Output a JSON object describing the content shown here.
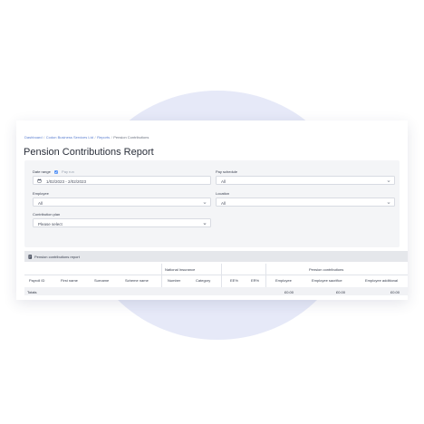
{
  "breadcrumbs": [
    {
      "label": "Dashboard"
    },
    {
      "label": "Codon Business Services Ltd"
    },
    {
      "label": "Reports"
    },
    {
      "label": "Pension Contributions"
    }
  ],
  "page_title": "Pension Contributions Report",
  "filters": {
    "date_range": {
      "label": "Date range",
      "toggle_label": "Pay run",
      "value": "1/02/2023 - 2/02/2023"
    },
    "pay_schedule": {
      "label": "Pay schedule",
      "value": "All"
    },
    "employee": {
      "label": "Employee",
      "value": "All"
    },
    "location": {
      "label": "Location",
      "value": "All"
    },
    "contribution_plan": {
      "label": "Contribution plan",
      "placeholder": "Please select"
    }
  },
  "table": {
    "title": "Pension contributions report",
    "group_headers": {
      "national_insurance": "National Insurance",
      "pension_contributions": "Pension contributions"
    },
    "columns": {
      "payroll_id": "Payroll ID",
      "first_name": "First name",
      "surname": "Surname",
      "scheme_name": "Scheme name",
      "number": "Number",
      "category": "Category",
      "ees": "EE%",
      "ers": "ER%",
      "employee": "Employee",
      "employee_sacrifice": "Employee sacrifice",
      "employee_additional": "Employee additional"
    },
    "totals": {
      "label": "Totals",
      "employee": "£0.00",
      "employee_sacrifice": "£0.00",
      "employee_additional": "£0.00"
    }
  },
  "colors": {
    "link": "#5b7fd0",
    "accent": "#3b82f6",
    "background_blob": "#e6e9f8"
  }
}
